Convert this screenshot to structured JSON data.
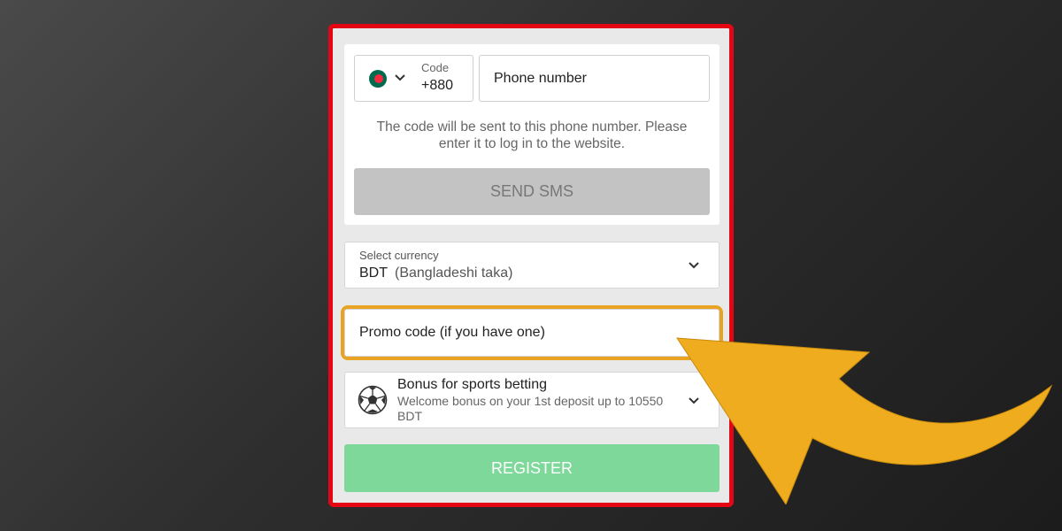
{
  "phone_form": {
    "country_flag": "bangladesh-flag-icon",
    "code_label": "Code",
    "code_value": "+880",
    "phone_placeholder": "Phone number",
    "hint": "The code will be sent to this phone number. Please enter it to log in to the website.",
    "send_sms_label": "SEND SMS"
  },
  "currency": {
    "label": "Select currency",
    "code": "BDT",
    "name": "(Bangladeshi taka)"
  },
  "promo": {
    "placeholder": "Promo code (if you have one)"
  },
  "bonus": {
    "icon": "soccer-ball-icon",
    "title": "Bonus for sports betting",
    "description": "Welcome bonus on your 1st deposit up to 10550 BDT"
  },
  "register_label": "REGISTER",
  "colors": {
    "frame_border": "#e30613",
    "highlight": "#e8a323",
    "send_button": "#c3c3c3",
    "register_button": "#7dd89a"
  }
}
